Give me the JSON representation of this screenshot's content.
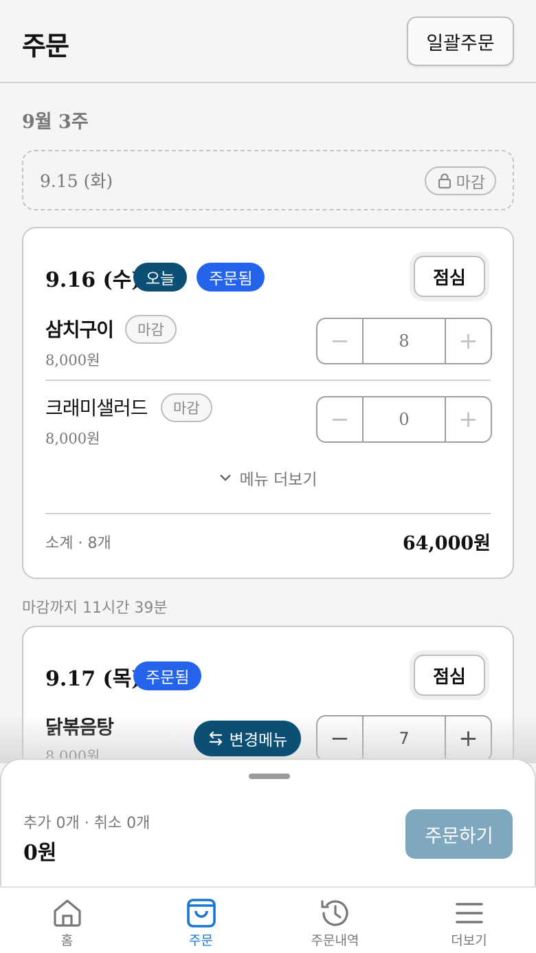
{
  "header": {
    "title": "주문",
    "bulk_order_label": "일괄주문"
  },
  "week_label": "9월 3주",
  "closed_day": {
    "date": "9.15 (화)",
    "badge": "마감"
  },
  "days": [
    {
      "date": "9.16 (수)",
      "badges": [
        "오늘",
        "주문됨"
      ],
      "meal": "점심",
      "items": [
        {
          "name": "삼치구이",
          "status": "마감",
          "price": "8,000원",
          "qty": "8"
        },
        {
          "name": "크래미샐러드",
          "status": "마감",
          "price": "8,000원",
          "qty": "0"
        }
      ],
      "more_menu": "메뉴 더보기",
      "subtotal_label": "소계 · 8개",
      "subtotal_amount": "64,000원"
    },
    {
      "deadline": "마감까지 11시간 39분",
      "date": "9.17 (목)",
      "badges": [
        "주문됨"
      ],
      "meal": "점심",
      "items": [
        {
          "name": "닭볶음탕",
          "price": "8,000원",
          "qty": "7",
          "change_menu": "변경메뉴"
        }
      ]
    }
  ],
  "sheet": {
    "summary": "추가 0개 · 취소 0개",
    "total": "0원",
    "order_button": "주문하기"
  },
  "tabs": [
    {
      "label": "홈",
      "icon": "home-icon"
    },
    {
      "label": "주문",
      "icon": "shopping-bag-icon",
      "active": true
    },
    {
      "label": "주문내역",
      "icon": "history-icon"
    },
    {
      "label": "더보기",
      "icon": "menu-icon"
    }
  ],
  "colors": {
    "primary_dark": "#0b4f74",
    "ordered_blue": "#2563eb",
    "active_tab": "#1976d2",
    "order_button_disabled": "#7fa8bf"
  }
}
